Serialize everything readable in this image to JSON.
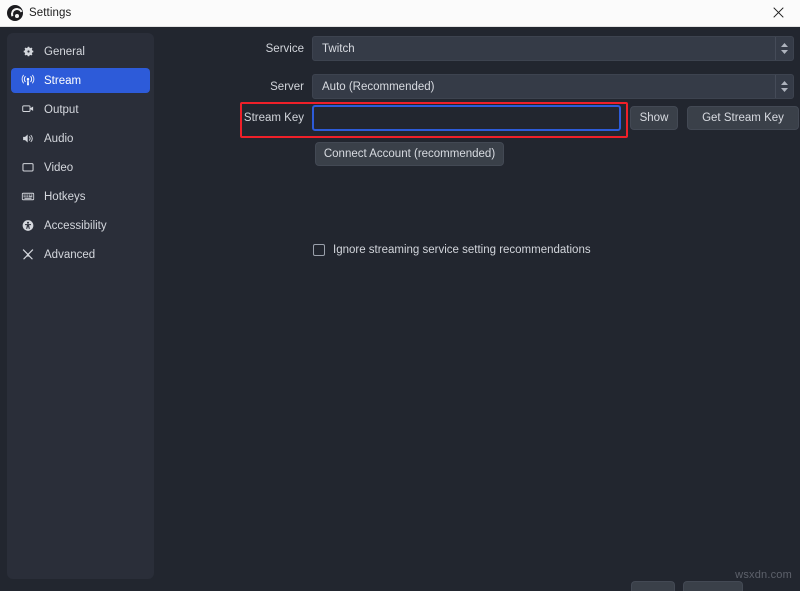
{
  "window": {
    "title": "Settings",
    "logo_icon": "obs-logo-icon",
    "close_icon": "close-icon"
  },
  "sidebar": {
    "items": [
      {
        "label": "General",
        "icon": "gear-icon",
        "selected": false
      },
      {
        "label": "Stream",
        "icon": "broadcast-icon",
        "selected": true
      },
      {
        "label": "Output",
        "icon": "output-screen-icon",
        "selected": false
      },
      {
        "label": "Audio",
        "icon": "speaker-icon",
        "selected": false
      },
      {
        "label": "Video",
        "icon": "monitor-icon",
        "selected": false
      },
      {
        "label": "Hotkeys",
        "icon": "keyboard-icon",
        "selected": false
      },
      {
        "label": "Accessibility",
        "icon": "accessibility-icon",
        "selected": false
      },
      {
        "label": "Advanced",
        "icon": "tools-icon",
        "selected": false
      }
    ]
  },
  "stream_settings": {
    "service": {
      "label": "Service",
      "value": "Twitch",
      "spinner_icon": "spinner-arrows-icon"
    },
    "server": {
      "label": "Server",
      "value": "Auto (Recommended)",
      "spinner_icon": "spinner-arrows-icon"
    },
    "stream_key": {
      "label": "Stream Key",
      "value": "",
      "placeholder": "",
      "show_button": "Show",
      "get_key_button": "Get Stream Key"
    },
    "connect_account_button": "Connect Account (recommended)",
    "ignore_recommendations": {
      "label": "Ignore streaming service setting recommendations",
      "checked": false
    }
  },
  "annotation": {
    "highlight_color": "#ef2029",
    "focus_color": "#2d5bd9"
  },
  "watermark": "wsxdn.com"
}
